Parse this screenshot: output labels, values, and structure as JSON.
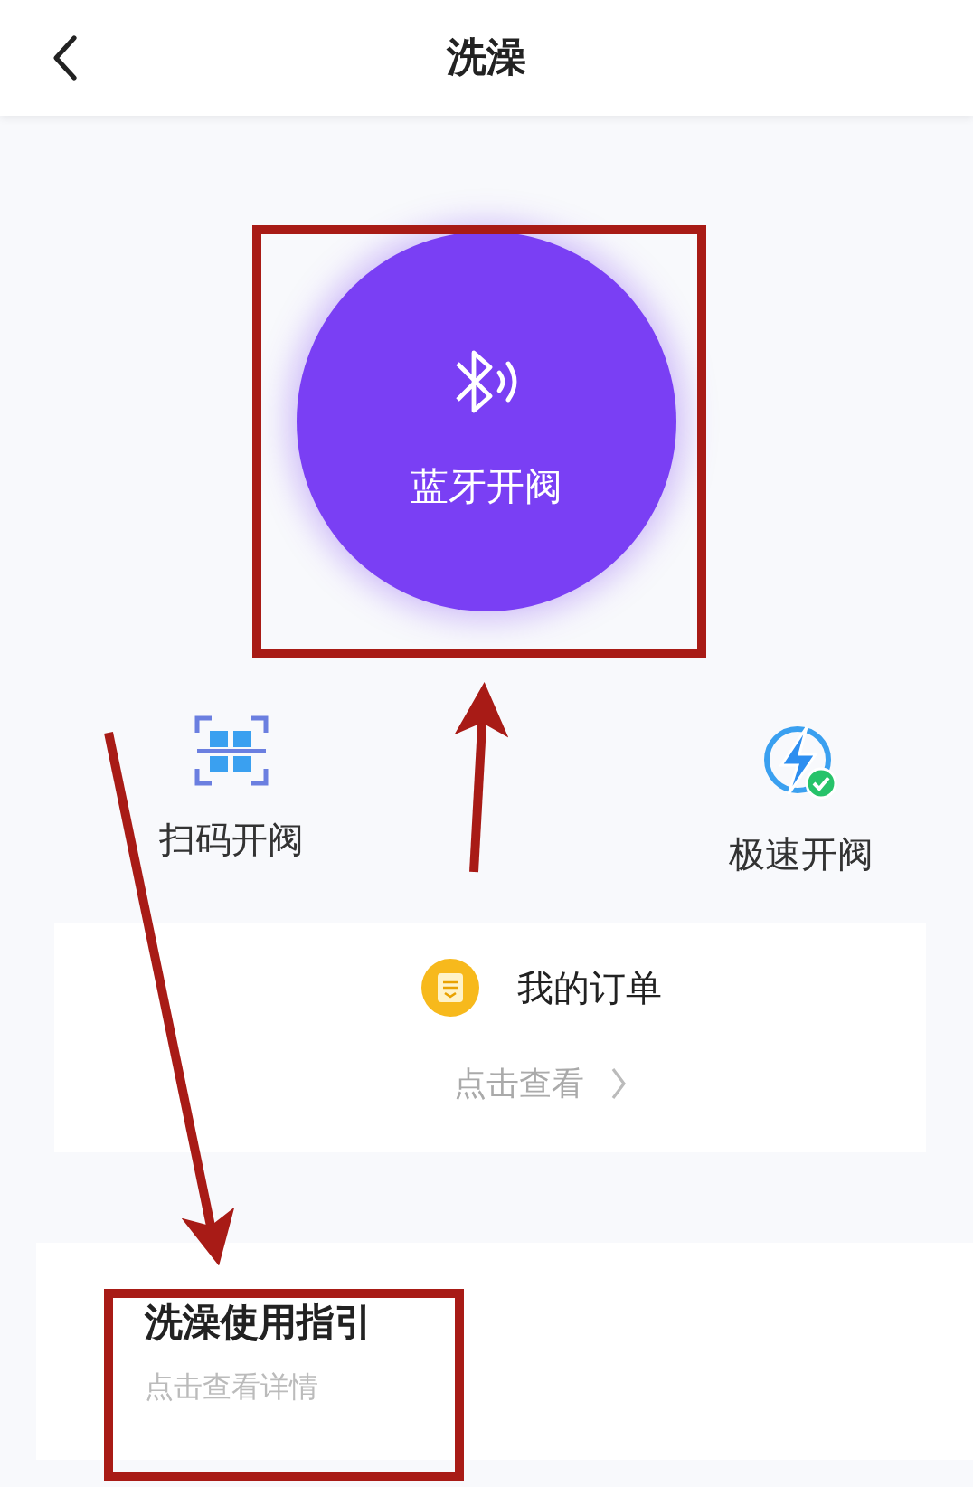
{
  "header": {
    "title": "洗澡"
  },
  "main_button": {
    "label": "蓝牙开阀"
  },
  "actions": [
    {
      "kind": "scan",
      "label": "扫码开阀"
    },
    {
      "kind": "fast",
      "label": "极速开阀"
    }
  ],
  "order": {
    "title": "我的订单",
    "link": "点击查看"
  },
  "guide": {
    "title": "洗澡使用指引",
    "subtitle": "点击查看详情"
  }
}
